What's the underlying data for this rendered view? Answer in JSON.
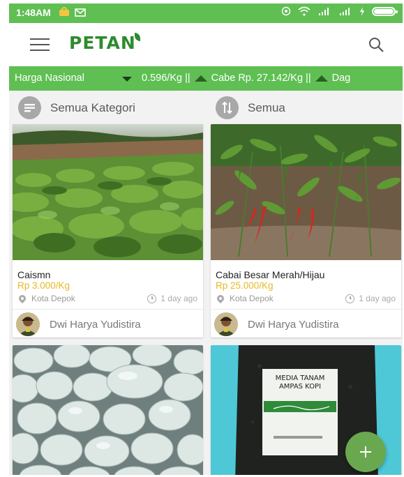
{
  "status": {
    "time": "1:48AM",
    "icons_left": [
      "notification-icon",
      "mail-icon"
    ],
    "icons_right": [
      "hotspot-icon",
      "wifi-icon",
      "signal-icon",
      "signal-icon",
      "charging-icon",
      "battery-icon"
    ]
  },
  "appbar": {
    "title": "PETANI",
    "title_text": "PETAN",
    "menu_icon": "menu-icon",
    "search_icon": "search-icon"
  },
  "ticker": {
    "label": "Harga Nasional",
    "segment1": "0.596/Kg ||",
    "segment2": "Cabe Rp. 27.142/Kg ||",
    "segment3": "Dag"
  },
  "filters": {
    "category_label": "Semua Kategori",
    "sort_label": "Semua",
    "category_icon": "category-icon",
    "sort_icon": "sort-icon"
  },
  "cards": [
    {
      "title": "Caismn",
      "price": "Rp 3.000/Kg",
      "location": "Kota Depok",
      "time": "1 day ago",
      "user": "Dwi Harya Yudistira",
      "image": "vegetable-field-image"
    },
    {
      "title": "Cabai Besar Merah/Hijau",
      "price": "Rp 25.000/Kg",
      "location": "Kota Depok",
      "time": "1 day ago",
      "user": "Dwi Harya Yudistira",
      "image": "chili-plants-image"
    },
    {
      "image": "white-granules-image"
    },
    {
      "image": "coffee-media-bag-image",
      "bag_label_line1": "MEDIA TANAM",
      "bag_label_line2": "AMPAS KOPI"
    }
  ],
  "colors": {
    "primary": "#5fbf53",
    "logo": "#2e8b2e",
    "price": "#e8b923",
    "fab": "#6aa84f"
  },
  "fab_icon": "add-icon"
}
